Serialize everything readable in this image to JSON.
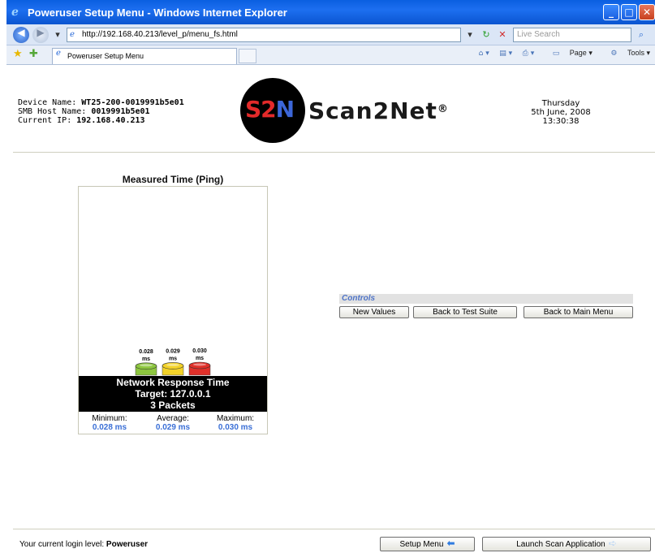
{
  "window": {
    "title": "Poweruser Setup Menu - Windows Internet Explorer",
    "url": "http://192.168.40.213/level_p/menu_fs.html",
    "search_placeholder": "Live Search",
    "tab_label": "Poweruser Setup Menu",
    "toolbar": {
      "page_label": "Page",
      "tools_label": "Tools"
    }
  },
  "device": {
    "name_label": "Device Name:",
    "name_value": "WT25-200-0019991b5e01",
    "smb_label": "SMB Host Name:",
    "smb_value": "0019991b5e01",
    "ip_label": "Current IP:",
    "ip_value": "192.168.40.213"
  },
  "logo": {
    "mark": "S2N",
    "word": "Scan2Net",
    "reg": "®"
  },
  "date": {
    "weekday": "Thursday",
    "date": "5th June, 2008",
    "time": "13:30:38"
  },
  "chart_data": {
    "type": "bar",
    "title": "Measured Time (Ping)",
    "categories": [
      "Minimum",
      "Average",
      "Maximum"
    ],
    "values": [
      0.028,
      0.029,
      0.03
    ],
    "value_labels": [
      "0.028",
      "0.029",
      "0.030"
    ],
    "unit": "ms",
    "colors": [
      "#8dc63f",
      "#f2d229",
      "#e0302a"
    ],
    "caption": [
      "Network Response Time",
      "Target: 127.0.0.1",
      "3 Packets"
    ],
    "stats": [
      {
        "label": "Minimum:",
        "value": "0.028 ms"
      },
      {
        "label": "Average:",
        "value": "0.029 ms"
      },
      {
        "label": "Maximum:",
        "value": "0.030 ms"
      }
    ]
  },
  "controls": {
    "heading": "Controls",
    "new_values": "New Values",
    "back_test_suite": "Back to Test Suite",
    "back_main_menu": "Back to Main Menu"
  },
  "footer": {
    "login_text": "Your current login level:",
    "login_level": "Poweruser",
    "setup_menu": "Setup Menu",
    "launch_scan": "Launch Scan Application"
  }
}
